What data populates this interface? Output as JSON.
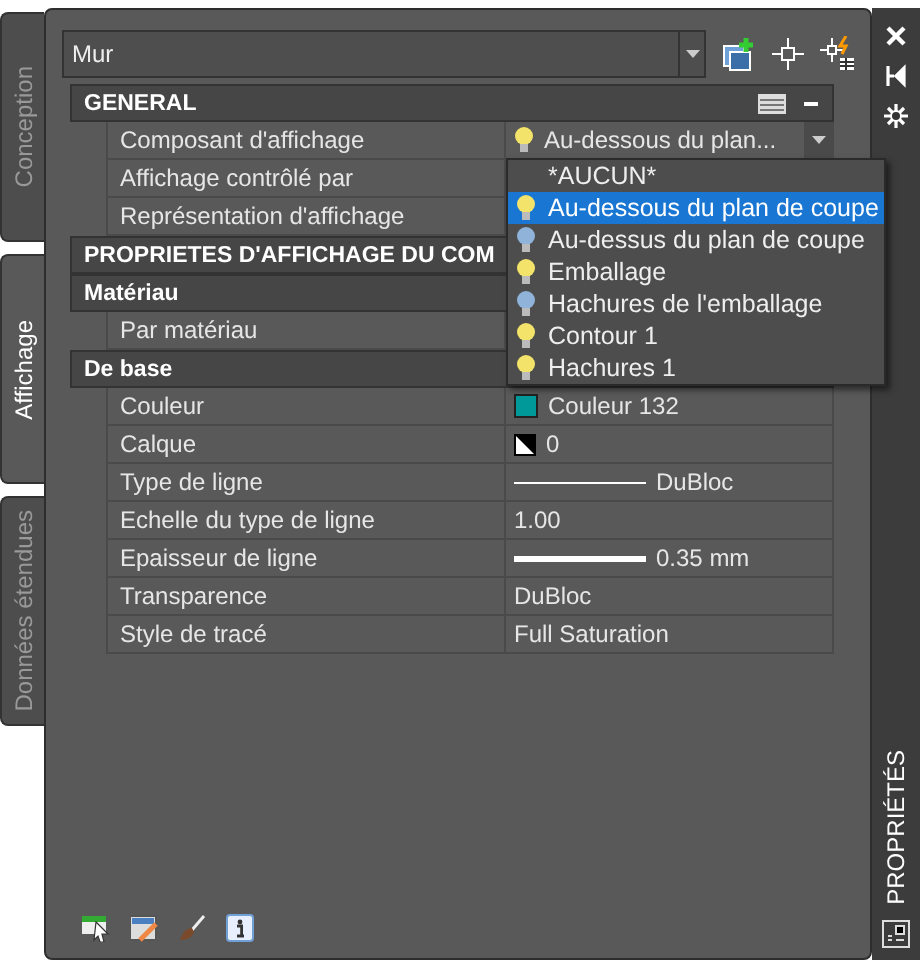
{
  "side_tabs": [
    {
      "label": "Conception",
      "selected": false
    },
    {
      "label": "Affichage",
      "selected": true
    },
    {
      "label": "Données étendues",
      "selected": false
    }
  ],
  "object_type": {
    "value": "Mur"
  },
  "rows": [
    {
      "kind": "section",
      "name": "GENERAL",
      "tools": true
    },
    {
      "kind": "select",
      "name": "Composant d'affichage",
      "value": "Au-dessous du plan...",
      "on": true
    },
    {
      "kind": "text",
      "name": "Affichage contrôlé par"
    },
    {
      "kind": "text",
      "name": "Représentation d'affichage"
    },
    {
      "kind": "section",
      "name": "PROPRIETES D'AFFICHAGE DU COM"
    },
    {
      "kind": "section",
      "name": "Matériau"
    },
    {
      "kind": "text",
      "name": "Par matériau"
    },
    {
      "kind": "section",
      "name": "De base"
    },
    {
      "kind": "color",
      "name": "Couleur",
      "value": "Couleur 132",
      "color": "#009999"
    },
    {
      "kind": "layer",
      "name": "Calque",
      "value": "0"
    },
    {
      "kind": "linetype",
      "name": "Type de ligne",
      "value": "DuBloc"
    },
    {
      "kind": "text",
      "name": "Echelle du type de ligne",
      "value": "1.00"
    },
    {
      "kind": "lineweight",
      "name": "Epaisseur de ligne",
      "value": "0.35 mm"
    },
    {
      "kind": "text",
      "name": "Transparence",
      "value": "DuBloc"
    },
    {
      "kind": "text",
      "name": "Style de tracé",
      "value": "Full Saturation"
    }
  ],
  "dropdown": [
    {
      "label": "*AUCUN*",
      "kind": "plain",
      "selected": false
    },
    {
      "label": "Au-dessous du plan de coupe",
      "kind": "bulb",
      "on": true,
      "selected": true
    },
    {
      "label": "Au-dessus du plan de coupe",
      "kind": "bulb",
      "on": false,
      "selected": false
    },
    {
      "label": "Emballage",
      "kind": "bulb",
      "on": true,
      "selected": false
    },
    {
      "label": "Hachures de l'emballage",
      "kind": "bulb",
      "on": false,
      "selected": false
    },
    {
      "label": "Contour 1",
      "kind": "bulb",
      "on": true,
      "selected": false
    },
    {
      "label": "Hachures 1",
      "kind": "bulb",
      "on": true,
      "selected": false
    }
  ],
  "palette": {
    "title": "PROPRIÉTÉS"
  }
}
